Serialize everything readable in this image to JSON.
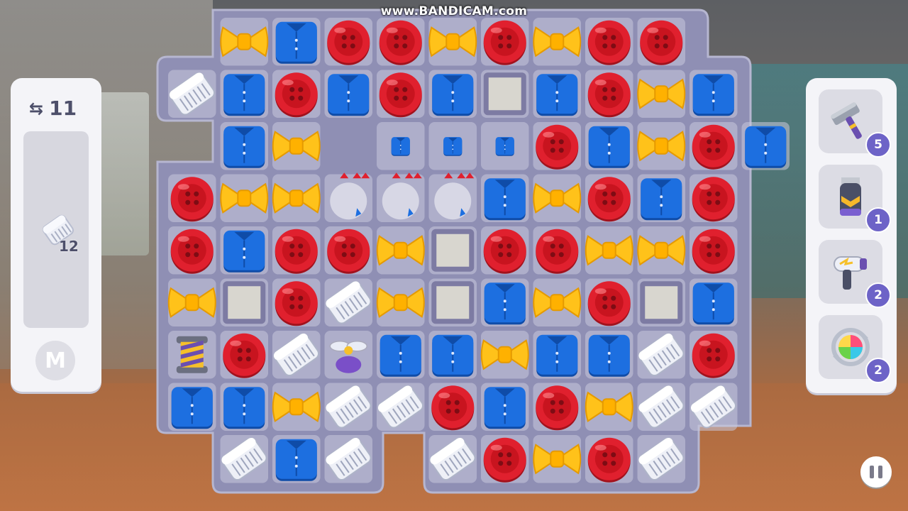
{
  "watermark": "www.BANDICAM.com",
  "moves": {
    "value": "11",
    "icon": "moves-arrows-icon"
  },
  "goal": {
    "item": "comb",
    "count": "12"
  },
  "menu_button": {
    "label": "M"
  },
  "boosters": [
    {
      "name": "hammer",
      "count": "5"
    },
    {
      "name": "clipper",
      "count": "1"
    },
    {
      "name": "hair-dryer",
      "count": "2"
    },
    {
      "name": "shuffle",
      "count": "2"
    }
  ],
  "pause": {
    "icon": "pause-icon"
  },
  "colors": {
    "board": "#8f8fb4",
    "cell": "#c9c9dd",
    "button_red": "#e0202e",
    "shirt_blue": "#1d6fe0",
    "bow_yellow": "#ffc21a",
    "comb_white": "#eef0f7",
    "booster_badge": "#6d63c7"
  },
  "board": {
    "legend": "B=button R=bow S=shirt C=comb s=small-shirt X=cleared .=empty w=window-block P=striped-booster F=propeller",
    "rows": [
      ".RSBBRBRBB.",
      "CSBSBSwSBRS",
      ".SR.sssBSRBS",
      "BRRxxxSRBSB",
      "BSBBRwBBRRB",
      "RwBCRwSRBwS",
      "PBCFSSRSSCB",
      "SSRCCBSBRCC",
      ".CSC.CBRBC."
    ]
  }
}
